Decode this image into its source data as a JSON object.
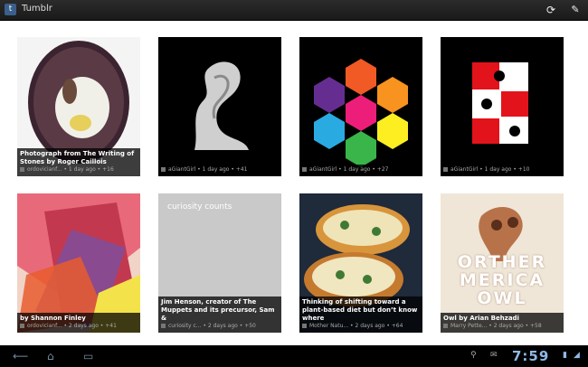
{
  "app": {
    "title": "Tumblr"
  },
  "tiles": [
    {
      "caption": "Photograph from The Writing of Stones by Roger Caillois",
      "meta": "ordovicianf... • 1 day ago • +16"
    },
    {
      "caption": "",
      "meta": "aGiantGirl • 1 day ago • +41"
    },
    {
      "caption": "",
      "meta": "aGiantGirl • 1 day ago • +27"
    },
    {
      "caption": "",
      "meta": "aGiantGirl • 1 day ago • +10"
    },
    {
      "caption": "by Shannon Finley",
      "meta": "ordovicianf... • 2 days ago • +41"
    },
    {
      "caption": "Jim Henson, creator of The Muppets and its precursor, Sam &",
      "meta": "curiosity c... • 2 days ago • +50",
      "image_text": "curiosity counts"
    },
    {
      "caption": "Thinking of shifting toward a plant-based diet but don’t know where",
      "meta": "Mother Natu... • 2 days ago • +64"
    },
    {
      "caption": "Owl by Arian Behzadi",
      "meta": "Marry Pette... • 2 days ago • +58",
      "image_text": "ORTHER MERICA OWL"
    }
  ],
  "system": {
    "clock": "7:59"
  },
  "icons": [
    "tumblr-app-icon",
    "refresh-icon",
    "compose-icon",
    "back-icon",
    "home-icon",
    "recent-apps-icon",
    "usb-icon",
    "mail-icon",
    "battery-icon",
    "signal-icon"
  ]
}
